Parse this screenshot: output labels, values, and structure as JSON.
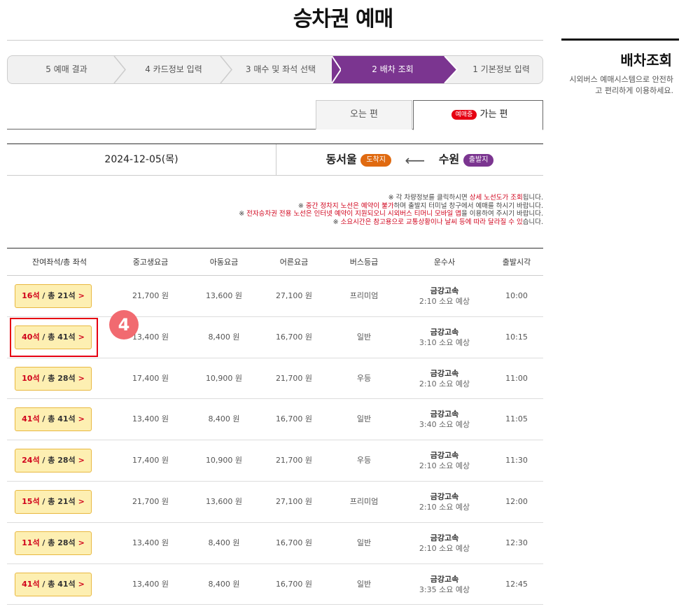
{
  "page": {
    "title": "승차권 예매"
  },
  "sidebar": {
    "title": "배차조회",
    "desc_line1": "시외버스 예매시스템으로 안전하",
    "desc_line2": "고 편리하게 이용하세요."
  },
  "steps": [
    {
      "label": "1 기본정보 입력",
      "active": false
    },
    {
      "label": "2 배차 조회",
      "active": true
    },
    {
      "label": "3 매수 및 좌석 선택",
      "active": false
    },
    {
      "label": "4 카드정보 입력",
      "active": false
    },
    {
      "label": "5 예매 결과",
      "active": false
    }
  ],
  "tabs": {
    "depart_label": "가는 편",
    "depart_badge": "예매중",
    "return_label": "오는 편"
  },
  "route": {
    "depart_badge": "출발지",
    "depart_name": "수원",
    "arrive_badge": "도착지",
    "arrive_name": "동서울",
    "date": "2024-12-05(목)"
  },
  "notices": {
    "n1_pre": "※ 각 차량정보를 클릭하시면 ",
    "n1_red": "상세 노선도가 조회",
    "n1_post": "됩니다.",
    "n2_pre": "※ ",
    "n2_red": "중간 정차지 노선은 예약이 불가",
    "n2_post": "하며 출발지 터미널 창구에서 예매를 하시기 바랍니다.",
    "n3_pre": "※ ",
    "n3_red": "전자승차권 전용 노선은 인터넷 예약이 지원되오니 시외버스 티머니 모바일 앱",
    "n3_post": "을 이용하여 주시기 바랍니다.",
    "n4_pre": "※ ",
    "n4_red": "소요시간은 참고용으로 교통상황이나 날씨 등에 따라 달라질 수 있",
    "n4_post": "습니다."
  },
  "table": {
    "headers": {
      "time": "출발시각",
      "company": "운수사",
      "grade": "버스등급",
      "adult": "어른요금",
      "child": "아동요금",
      "student": "중고생요금",
      "seats": "잔여좌석/총 좌석"
    },
    "rows": [
      {
        "time": "10:00",
        "company": "금강고속",
        "duration": "2:10 소요 예상",
        "grade": "프리미엄",
        "adult": "27,100 원",
        "child": "13,600 원",
        "student": "21,700 원",
        "seat_avail": "16석",
        "seat_total": " / 총 21석"
      },
      {
        "time": "10:15",
        "company": "금강고속",
        "duration": "3:10 소요 예상",
        "grade": "일반",
        "adult": "16,700 원",
        "child": "8,400 원",
        "student": "13,400 원",
        "seat_avail": "40석",
        "seat_total": " / 총 41석"
      },
      {
        "time": "11:00",
        "company": "금강고속",
        "duration": "2:10 소요 예상",
        "grade": "우등",
        "adult": "21,700 원",
        "child": "10,900 원",
        "student": "17,400 원",
        "seat_avail": "10석",
        "seat_total": " / 총 28석"
      },
      {
        "time": "11:05",
        "company": "금강고속",
        "duration": "3:40 소요 예상",
        "grade": "일반",
        "adult": "16,700 원",
        "child": "8,400 원",
        "student": "13,400 원",
        "seat_avail": "41석",
        "seat_total": " / 총 41석"
      },
      {
        "time": "11:30",
        "company": "금강고속",
        "duration": "2:10 소요 예상",
        "grade": "우등",
        "adult": "21,700 원",
        "child": "10,900 원",
        "student": "17,400 원",
        "seat_avail": "24석",
        "seat_total": " / 총 28석"
      },
      {
        "time": "12:00",
        "company": "금강고속",
        "duration": "2:10 소요 예상",
        "grade": "프리미엄",
        "adult": "27,100 원",
        "child": "13,600 원",
        "student": "21,700 원",
        "seat_avail": "15석",
        "seat_total": " / 총 21석"
      },
      {
        "time": "12:30",
        "company": "금강고속",
        "duration": "2:10 소요 예상",
        "grade": "일반",
        "adult": "16,700 원",
        "child": "8,400 원",
        "student": "13,400 원",
        "seat_avail": "11석",
        "seat_total": " / 총 28석"
      },
      {
        "time": "12:45",
        "company": "금강고속",
        "duration": "3:35 소요 예상",
        "grade": "일반",
        "adult": "16,700 원",
        "child": "8,400 원",
        "student": "13,400 원",
        "seat_avail": "41석",
        "seat_total": " / 총 41석"
      }
    ]
  },
  "annotation": {
    "step_number": "4"
  },
  "colors": {
    "accent": "#7b3590",
    "highlight": "#e60012",
    "seat_btn": "#fdefb2",
    "arrive": "#e06a10"
  }
}
